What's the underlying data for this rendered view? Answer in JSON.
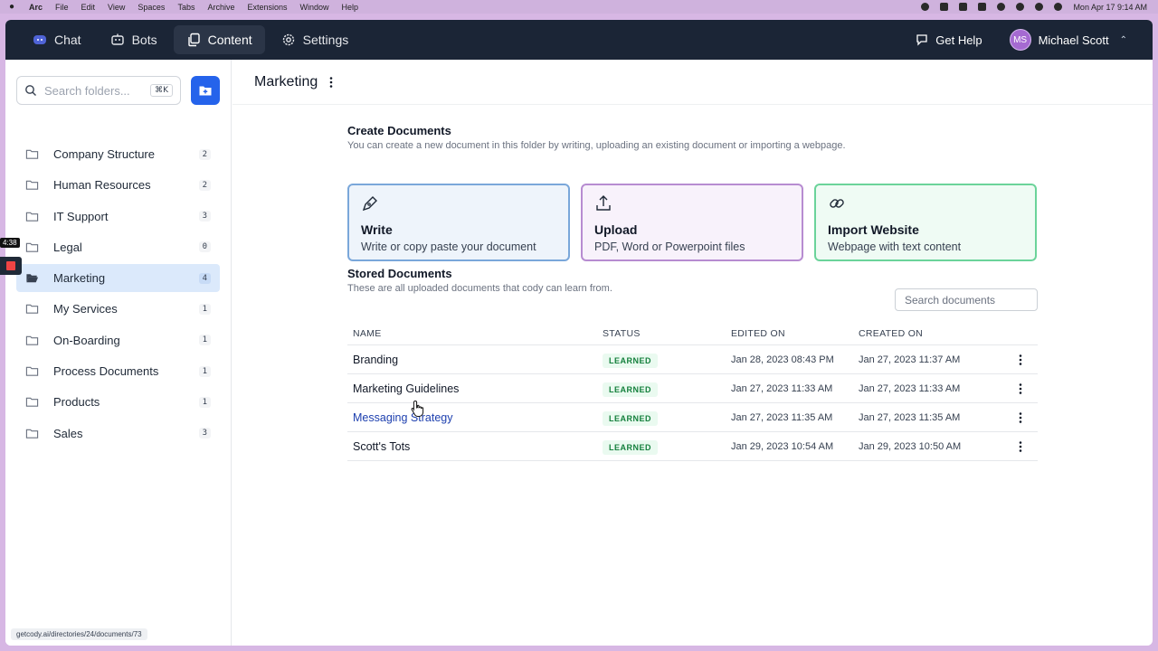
{
  "menubar": {
    "items": [
      "Arc",
      "File",
      "Edit",
      "View",
      "Spaces",
      "Tabs",
      "Archive",
      "Extensions",
      "Window",
      "Help"
    ],
    "datetime": "Mon Apr 17  9:14 AM"
  },
  "topnav": {
    "items": [
      {
        "label": "Chat",
        "icon": "chat-bubble-icon"
      },
      {
        "label": "Bots",
        "icon": "bot-icon"
      },
      {
        "label": "Content",
        "icon": "copy-icon",
        "active": true
      },
      {
        "label": "Settings",
        "icon": "gear-icon"
      }
    ],
    "help_label": "Get Help",
    "user_initials": "MS",
    "user_name": "Michael Scott"
  },
  "sidebar": {
    "search_placeholder": "Search folders...",
    "shortcut": "⌘K",
    "folders": [
      {
        "label": "Company Structure",
        "count": "2"
      },
      {
        "label": "Human Resources",
        "count": "2"
      },
      {
        "label": "IT Support",
        "count": "3"
      },
      {
        "label": "Legal",
        "count": "0"
      },
      {
        "label": "Marketing",
        "count": "4",
        "active": true
      },
      {
        "label": "My Services",
        "count": "1"
      },
      {
        "label": "On-Boarding",
        "count": "1"
      },
      {
        "label": "Process Documents",
        "count": "1"
      },
      {
        "label": "Products",
        "count": "1"
      },
      {
        "label": "Sales",
        "count": "3"
      }
    ],
    "url": "getcody.ai/directories/24/documents/73"
  },
  "main": {
    "title": "Marketing",
    "create": {
      "title": "Create Documents",
      "subtitle": "You can create a new document in this folder by writing, uploading an existing document or importing a webpage.",
      "cards": [
        {
          "title": "Write",
          "desc": "Write or copy paste your document"
        },
        {
          "title": "Upload",
          "desc": "PDF, Word or Powerpoint files"
        },
        {
          "title": "Import Website",
          "desc": "Webpage with text content"
        }
      ]
    },
    "stored": {
      "title": "Stored Documents",
      "subtitle": "These are all uploaded documents that cody can learn from.",
      "search_placeholder": "Search documents",
      "columns": [
        "NAME",
        "STATUS",
        "EDITED ON",
        "CREATED ON"
      ],
      "rows": [
        {
          "name": "Branding",
          "status": "LEARNED",
          "edited": "Jan 28, 2023 08:43 PM",
          "created": "Jan 27, 2023 11:37 AM"
        },
        {
          "name": "Marketing Guidelines",
          "status": "LEARNED",
          "edited": "Jan 27, 2023 11:33 AM",
          "created": "Jan 27, 2023 11:33 AM"
        },
        {
          "name": "Messaging Strategy",
          "status": "LEARNED",
          "edited": "Jan 27, 2023 11:35 AM",
          "created": "Jan 27, 2023 11:35 AM"
        },
        {
          "name": "Scott's Tots",
          "status": "LEARNED",
          "edited": "Jan 29, 2023 10:54 AM",
          "created": "Jan 29, 2023 10:50 AM"
        }
      ]
    }
  },
  "recording": {
    "timer": "4:38"
  },
  "colors": {
    "nav_bg": "#1b2536",
    "accent": "#2563eb",
    "active_folder": "#dbe9fb",
    "learned": "#15803d"
  }
}
